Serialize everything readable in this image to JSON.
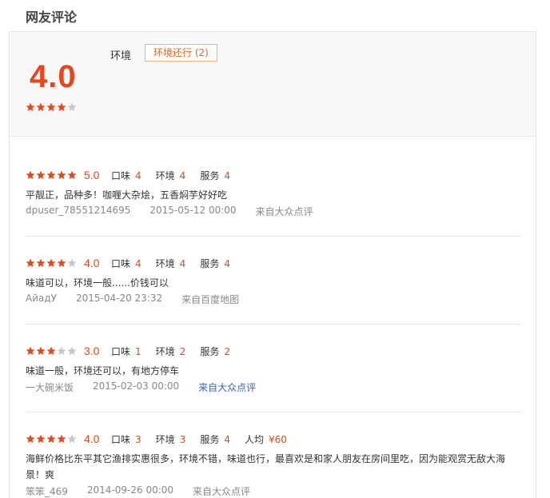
{
  "section_title": "网友评论",
  "summary": {
    "score": "4.0",
    "stars": 4,
    "tag_label": "环境",
    "tag_chip": "环境还行 (2)"
  },
  "colors": {
    "accent": "#e8461d",
    "star_on": "#e8461d",
    "star_off": "#c7c7c7",
    "source_link": "#3b63b8"
  },
  "reviews": [
    {
      "stars": 5,
      "score": "5.0",
      "taste_label": "口味",
      "taste": "4",
      "env_label": "环境",
      "env": "4",
      "service_label": "服务",
      "service": "4",
      "text": "平靓正，品种多！咖喱大杂烩，五香焖芋好好吃",
      "user": "dpuser_78551214695",
      "time": "2015-05-12 00:00",
      "source": "来自大众点评"
    },
    {
      "stars": 4,
      "score": "4.0",
      "taste_label": "口味",
      "taste": "4",
      "env_label": "环境",
      "env": "4",
      "service_label": "服务",
      "service": "4",
      "text": "味道可以，环境一般......价钱可以",
      "user": "АйадУ",
      "time": "2015-04-20 23:32",
      "source": "来自百度地图"
    },
    {
      "stars": 3,
      "score": "3.0",
      "taste_label": "口味",
      "taste": "1",
      "env_label": "环境",
      "env": "2",
      "service_label": "服务",
      "service": "2",
      "text": "味道一般，环境还可以，有地方停车",
      "user": "一大碗米饭",
      "time": "2015-02-03 00:00",
      "source": "来自大众点评"
    },
    {
      "stars": 4,
      "score": "4.0",
      "taste_label": "口味",
      "taste": "3",
      "env_label": "环境",
      "env": "3",
      "service_label": "服务",
      "service": "4",
      "avg_label": "人均",
      "avg": "¥60",
      "text": "海鲜价格比东平其它渔排实惠很多，环境不错，味道也行，最喜欢是和家人朋友在房间里吃，因为能观赏无敌大海景！爽",
      "user": "笨笨_469",
      "time": "2014-09-26 00:00",
      "source": "来自大众点评"
    }
  ]
}
